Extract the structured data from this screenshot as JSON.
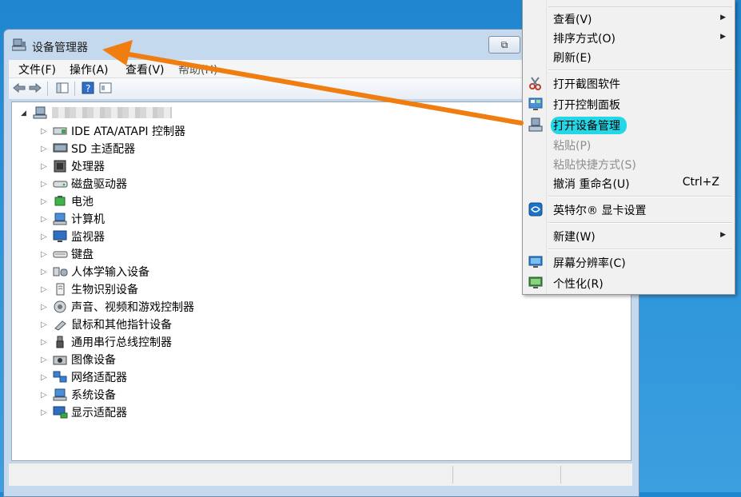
{
  "window": {
    "title": "设备管理器",
    "restore_glyph": "⧉",
    "menus": [
      "文件(F)",
      "操作(A)",
      "查看(V)",
      "帮助(H)"
    ]
  },
  "tree": {
    "root_label": "",
    "devices": [
      {
        "label": "IDE ATA/ATAPI 控制器",
        "icon": "ide-controller-icon"
      },
      {
        "label": "SD 主适配器",
        "icon": "sd-host-icon"
      },
      {
        "label": "处理器",
        "icon": "processor-icon"
      },
      {
        "label": "磁盘驱动器",
        "icon": "disk-drive-icon"
      },
      {
        "label": "电池",
        "icon": "battery-icon"
      },
      {
        "label": "计算机",
        "icon": "computer-icon"
      },
      {
        "label": "监视器",
        "icon": "monitor-icon"
      },
      {
        "label": "键盘",
        "icon": "keyboard-icon"
      },
      {
        "label": "人体学输入设备",
        "icon": "hid-icon"
      },
      {
        "label": "生物识别设备",
        "icon": "biometric-icon"
      },
      {
        "label": "声音、视频和游戏控制器",
        "icon": "sound-icon"
      },
      {
        "label": "鼠标和其他指针设备",
        "icon": "mouse-icon"
      },
      {
        "label": "通用串行总线控制器",
        "icon": "usb-icon"
      },
      {
        "label": "图像设备",
        "icon": "imaging-icon"
      },
      {
        "label": "网络适配器",
        "icon": "network-adapter-icon"
      },
      {
        "label": "系统设备",
        "icon": "system-devices-icon"
      },
      {
        "label": "显示适配器",
        "icon": "display-adapter-icon"
      }
    ]
  },
  "context_menu": {
    "view": "查看(V)",
    "sort": "排序方式(O)",
    "refresh": "刷新(E)",
    "open_snipping": "打开截图软件",
    "open_control_panel": "打开控制面板",
    "open_device_manager": "打开设备管理",
    "paste": "粘贴(P)",
    "paste_shortcut": "粘贴快捷方式(S)",
    "undo_rename": "撤消 重命名(U)",
    "undo_shortcut": "Ctrl+Z",
    "intel_graphics": "英特尔® 显卡设置",
    "new": "新建(W)",
    "screen_resolution": "屏幕分辨率(C)",
    "personalize": "个性化(R)"
  },
  "colors": {
    "highlight": "#23d7e6",
    "annotation_arrow": "#f07d10",
    "desktop": "#2a93da"
  }
}
